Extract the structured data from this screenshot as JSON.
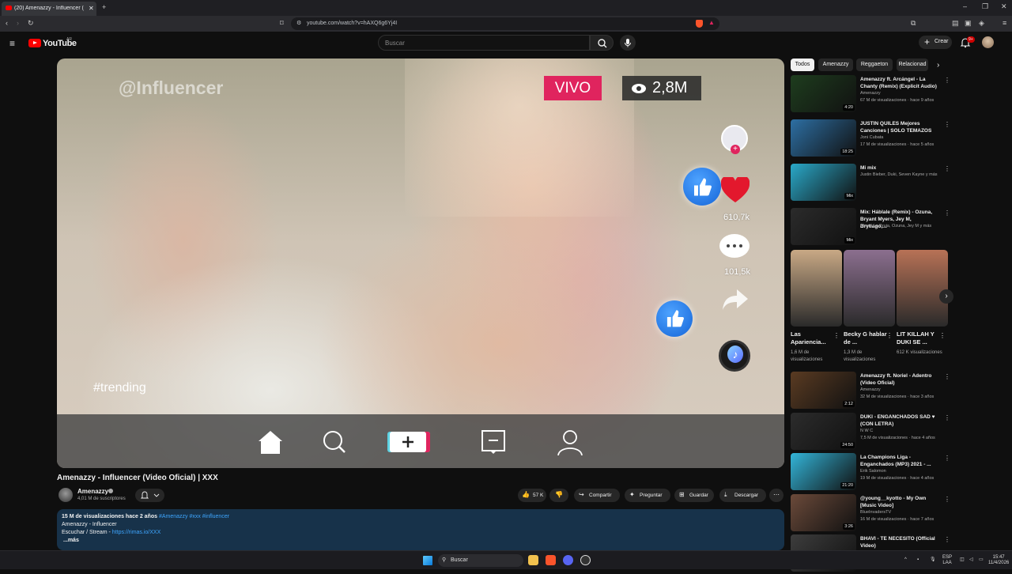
{
  "browser": {
    "tab_title": "(20) Amenazzy - Influencer (V",
    "url": "youtube.com/watch?v=hAXQ6g6Yj4I"
  },
  "youtube": {
    "logo": "YouTube",
    "region": "AR",
    "search_placeholder": "Buscar",
    "create_label": "Crear",
    "notification_count": "9+"
  },
  "video": {
    "handle": "@Influencer",
    "live_label": "VIVO",
    "viewers": "2,8M",
    "likes": "610,7k",
    "comments": "101,5k",
    "hashtag": "#trending"
  },
  "below": {
    "title": "Amenazzy - Influencer (Video Oficial) | XXX",
    "channel": "Amenazzy",
    "subscribers": "4,01 M de suscriptores",
    "likes": "57 K",
    "share": "Compartir",
    "ask": "Preguntar",
    "save": "Guardar",
    "download": "Descargar"
  },
  "description": {
    "stats": "15 M de visualizaciones  hace 2 años",
    "tags": " #Amenazzy #xxx #influencer",
    "line1": "Amenazzy - Influencer",
    "line2_prefix": "Escuchar / Stream - ",
    "line2_link": "https://rimas.io/XXX",
    "more": "...más"
  },
  "chips": [
    "Todos",
    "Amenazzy",
    "Reggaeton",
    "Relacionad"
  ],
  "recs": [
    {
      "title": "Amenazzy ft. Arcángel - La Chanty (Remix) (Explicit Audio)",
      "channel": "Amenazzy",
      "meta": "67 M de visualizaciones · hace 9 años",
      "duration": "4:20",
      "color": "#1e3d1e"
    },
    {
      "title": "JUSTIN QUILES Mejores Canciones | SOLO TEMAZOS",
      "channel": "Joni Cubata",
      "meta": "17 M de visualizaciones · hace 5 años",
      "duration": "18:25",
      "color": "#2d6fa3"
    },
    {
      "title": "Mi mix",
      "channel": "Justin Bieber, Duki, Seven Kayne y más",
      "meta": "",
      "duration": "Mix",
      "color": "#2aa9c9"
    },
    {
      "title": "Mix: Háblale (Remix) - Ozuna, Bryant Myers, Jey M, Brytiago,...",
      "channel": "Alexio La Bruja, Ozuna, Jey M y más",
      "meta": "",
      "duration": "Mix",
      "color": "#2b2b2b"
    }
  ],
  "shorts": [
    {
      "title": "Las Apariencia...",
      "views": "1,6 M de visualizaciones",
      "color": "#c9a985"
    },
    {
      "title": "Becky G hablar de ...",
      "views": "1,3 M de visualizaciones",
      "color": "#8c6f8f"
    },
    {
      "title": "LIT KILLAH Y DUKI SE ...",
      "views": "612 K visualizaciones",
      "color": "#b87256"
    }
  ],
  "recs2": [
    {
      "title": "Amenazzy ft. Noriel - Adentro (Video Oficial)",
      "channel": "Amenazzy",
      "meta": "32 M de visualizaciones · hace 3 años",
      "duration": "2:12",
      "color": "#5a3b22"
    },
    {
      "title": "DUKI - ENGANCHADOS SAD ♥ (CON LETRA)",
      "channel": "N W C",
      "meta": "7,5 M de visualizaciones · hace 4 años",
      "duration": "24:50",
      "color": "#2c2c2c"
    },
    {
      "title": "La Champions Liga - Enganchados (MP3) 2021 - ...",
      "channel": "Erik Salomon",
      "meta": "19 M de visualizaciones · hace 4 años",
      "duration": "21:20",
      "color": "#33b5d9"
    },
    {
      "title": "@young__kyotto - My Own [Music Video]",
      "channel": "BlueInvadersTV",
      "meta": "16 M de visualizaciones · hace 7 años",
      "duration": "3:26",
      "color": "#6b4a3a"
    },
    {
      "title": "BHAVI - TE NECESITO (Official Video)",
      "channel": "",
      "meta": "",
      "duration": "",
      "color": "#3d3d3d"
    }
  ],
  "taskbar": {
    "search": "Buscar",
    "lang": "ESP",
    "layout": "LAA",
    "time": "15:47",
    "date": "11/4/2026"
  }
}
